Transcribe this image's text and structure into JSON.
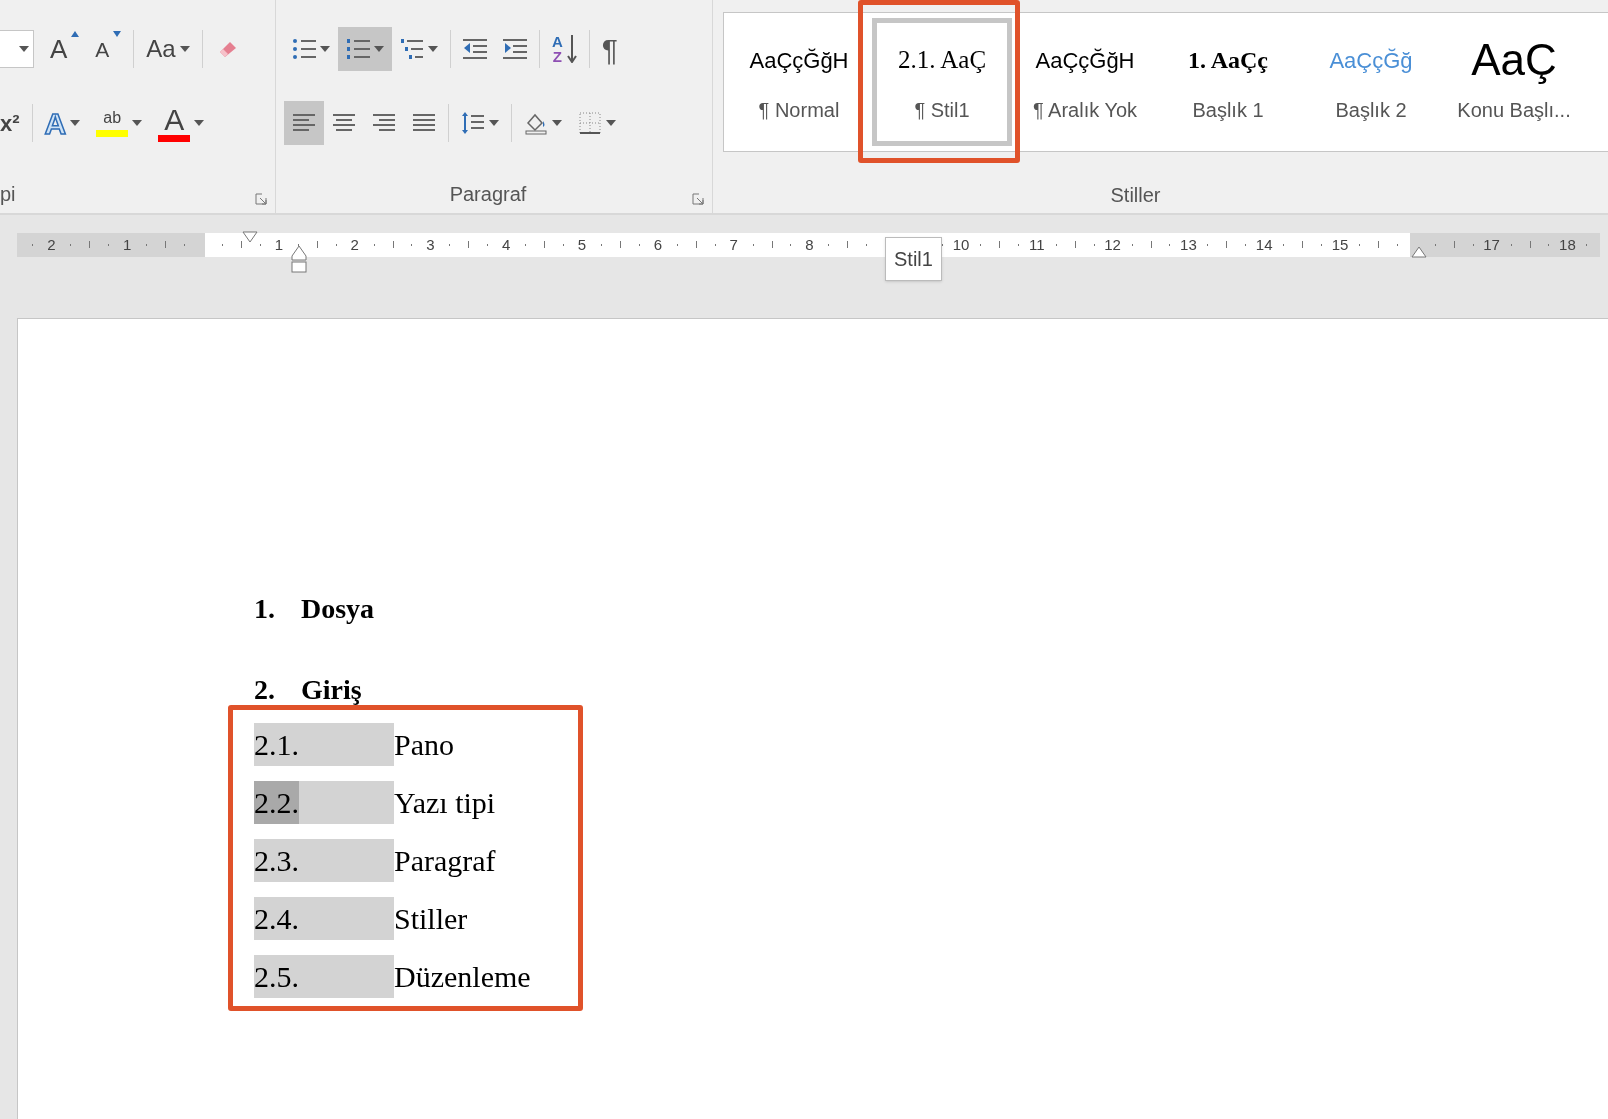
{
  "ribbon": {
    "groups": [
      {
        "kind": "font",
        "label": "pi",
        "rows": [
          {
            "items": [
              {
                "kind": "size_field"
              },
              {
                "kind": "grow_font",
                "label": "A"
              },
              {
                "kind": "shrink_font",
                "label": "A"
              },
              {
                "kind": "separator"
              },
              {
                "kind": "change_case",
                "label": "Aa"
              },
              {
                "kind": "separator"
              },
              {
                "kind": "clear_formatting"
              }
            ]
          },
          {
            "items": [
              {
                "kind": "superscript",
                "label": "x²"
              },
              {
                "kind": "separator"
              },
              {
                "kind": "text_effects",
                "label": "A"
              },
              {
                "kind": "highlight",
                "label": "ab"
              },
              {
                "kind": "font_color",
                "label": "A"
              }
            ]
          }
        ]
      },
      {
        "kind": "paragraph",
        "label": "Paragraf",
        "rows": [
          {
            "items": [
              {
                "kind": "bullets",
                "selected": false
              },
              {
                "kind": "numbering",
                "selected": true
              },
              {
                "kind": "multilevel",
                "selected": false
              },
              {
                "kind": "separator"
              },
              {
                "kind": "decrease_indent",
                "selected": false
              },
              {
                "kind": "increase_indent",
                "selected": false
              },
              {
                "kind": "separator"
              },
              {
                "kind": "sort",
                "label": "A",
                "label_bottom": "Z",
                "selected": false
              },
              {
                "kind": "separator"
              },
              {
                "kind": "show_marks",
                "label": "¶",
                "selected": false
              }
            ]
          },
          {
            "items": [
              {
                "kind": "align_left",
                "selected": true
              },
              {
                "kind": "align_center",
                "selected": false
              },
              {
                "kind": "align_right",
                "selected": false
              },
              {
                "kind": "justify",
                "selected": false
              },
              {
                "kind": "separator"
              },
              {
                "kind": "line_spacing",
                "selected": false
              },
              {
                "kind": "separator"
              },
              {
                "kind": "shading",
                "selected": false
              },
              {
                "kind": "borders",
                "selected": false
              }
            ]
          }
        ]
      },
      {
        "kind": "styles",
        "label": "Stiller",
        "styles": [
          {
            "preview": "AaÇçĞğH",
            "label": "¶ Normal",
            "kind": "normal",
            "selected": false,
            "framed": false
          },
          {
            "preview": "2.1.  AaÇ",
            "label": "¶ Stil1",
            "kind": "numbered",
            "selected": true,
            "framed": true
          },
          {
            "preview": "AaÇçĞğH",
            "label": "¶ Aralık Yok",
            "kind": "normal",
            "selected": false,
            "framed": false
          },
          {
            "preview": "1.  AaÇç",
            "label": "Başlık 1",
            "kind": "heading1",
            "selected": false,
            "framed": false
          },
          {
            "preview": "AaÇçĞğ",
            "label": "Başlık 2",
            "kind": "heading2",
            "selected": false,
            "framed": false
          },
          {
            "preview": "AaÇ",
            "label": "Konu Başlı...",
            "kind": "title",
            "selected": false,
            "framed": false
          }
        ]
      }
    ]
  },
  "ruler": {
    "numbers": [
      "2",
      "1",
      "1",
      "2",
      "3",
      "4",
      "5",
      "6",
      "7",
      "8",
      "10",
      "11",
      "12",
      "13",
      "14",
      "15",
      "17",
      "18"
    ],
    "tooltip": "Stil1"
  },
  "document": {
    "headings": [
      {
        "number": "1.",
        "text": "Dosya"
      },
      {
        "number": "2.",
        "text": "Giriş"
      }
    ],
    "list_framed": true,
    "items": [
      {
        "number": "2.1.",
        "text": "Pano",
        "selected": false
      },
      {
        "number": "2.2.",
        "text": "Yazı tipi",
        "selected": true
      },
      {
        "number": "2.3.",
        "text": "Paragraf",
        "selected": false
      },
      {
        "number": "2.4.",
        "text": "Stiller",
        "selected": false
      },
      {
        "number": "2.5.",
        "text": "Düzenleme",
        "selected": false
      }
    ]
  }
}
